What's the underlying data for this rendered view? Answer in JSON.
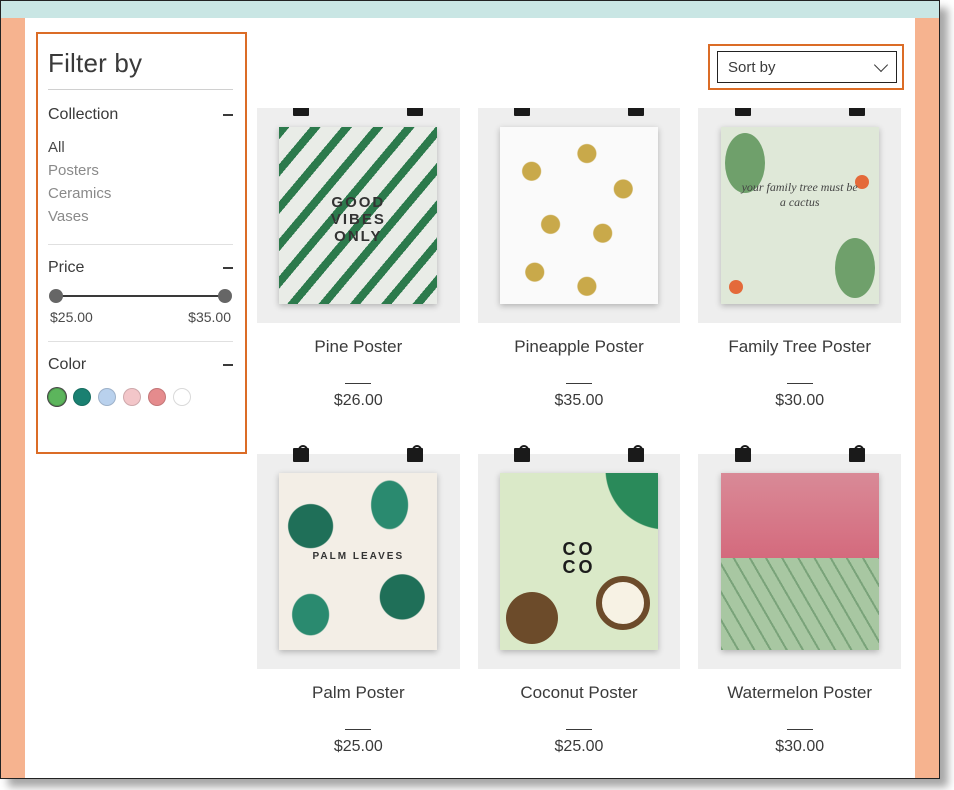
{
  "filter": {
    "title": "Filter by",
    "sections": {
      "collection": {
        "label": "Collection",
        "items": [
          "All",
          "Posters",
          "Ceramics",
          "Vases"
        ],
        "active_index": 0
      },
      "price": {
        "label": "Price",
        "min_label": "$25.00",
        "max_label": "$35.00"
      },
      "color": {
        "label": "Color",
        "swatches": [
          "#5cb55c",
          "#1a8071",
          "#b9d1ed",
          "#f3c6c9",
          "#e58b8d",
          "#ffffff"
        ]
      }
    }
  },
  "sort": {
    "label": "Sort by"
  },
  "products": [
    {
      "name": "Pine Poster",
      "price": "$26.00",
      "art": "pine",
      "art_text": "GOOD\nVIBES\nONLY"
    },
    {
      "name": "Pineapple Poster",
      "price": "$35.00",
      "art": "pineapple",
      "art_text": ""
    },
    {
      "name": "Family Tree Poster",
      "price": "$30.00",
      "art": "family",
      "art_text": "your family tree must be a cactus"
    },
    {
      "name": "Palm Poster",
      "price": "$25.00",
      "art": "palm",
      "art_text": "PALM LEAVES"
    },
    {
      "name": "Coconut Poster",
      "price": "$25.00",
      "art": "coconut",
      "art_text": "CO\nCO"
    },
    {
      "name": "Watermelon Poster",
      "price": "$30.00",
      "art": "watermelon",
      "art_text": ""
    }
  ]
}
